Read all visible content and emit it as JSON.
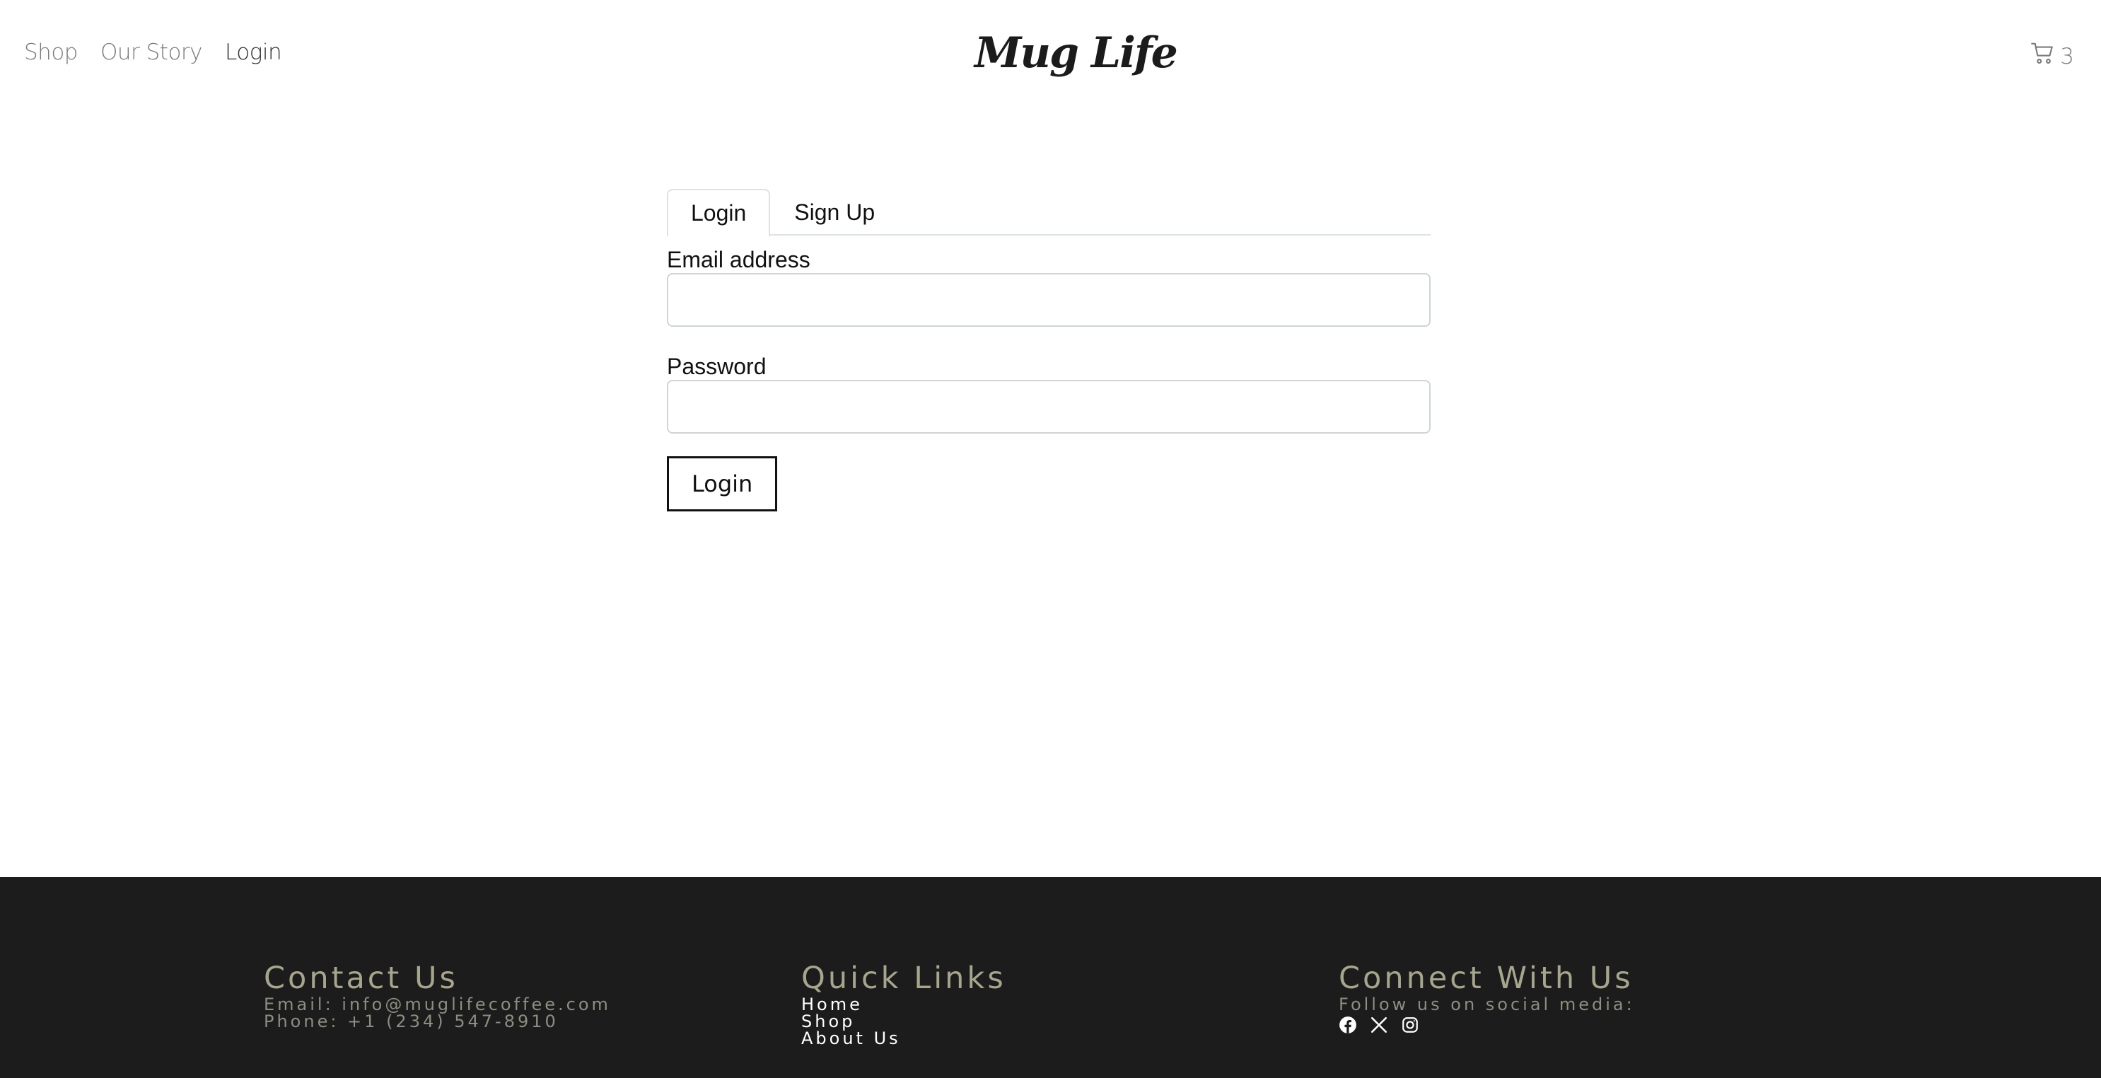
{
  "header": {
    "nav": [
      {
        "label": "Shop"
      },
      {
        "label": "Our Story"
      },
      {
        "label": "Login"
      }
    ],
    "logo": "Mug Life",
    "cart_count": "3",
    "cart_icon": "shopping-cart-icon"
  },
  "auth": {
    "tabs": [
      {
        "label": "Login",
        "active": true
      },
      {
        "label": "Sign Up",
        "active": false
      }
    ],
    "email_label": "Email address",
    "email_value": "",
    "password_label": "Password",
    "password_value": "",
    "submit_label": "Login"
  },
  "footer": {
    "contact": {
      "heading": "Contact Us",
      "email": "Email: info@muglifecoffee.com",
      "phone": "Phone: +1 (234) 547-8910"
    },
    "links": {
      "heading": "Quick Links",
      "items": [
        {
          "label": "Home"
        },
        {
          "label": "Shop"
        },
        {
          "label": "About Us"
        }
      ]
    },
    "connect": {
      "heading": "Connect With Us",
      "text": "Follow us on social media:",
      "icons": [
        "facebook-icon",
        "x-twitter-icon",
        "instagram-icon"
      ]
    }
  },
  "colors": {
    "footer_bg": "#1c1c1c",
    "footer_heading": "#a7a68d",
    "nav_text": "#7a7a7a",
    "nav_active": "#2f2f2f"
  }
}
